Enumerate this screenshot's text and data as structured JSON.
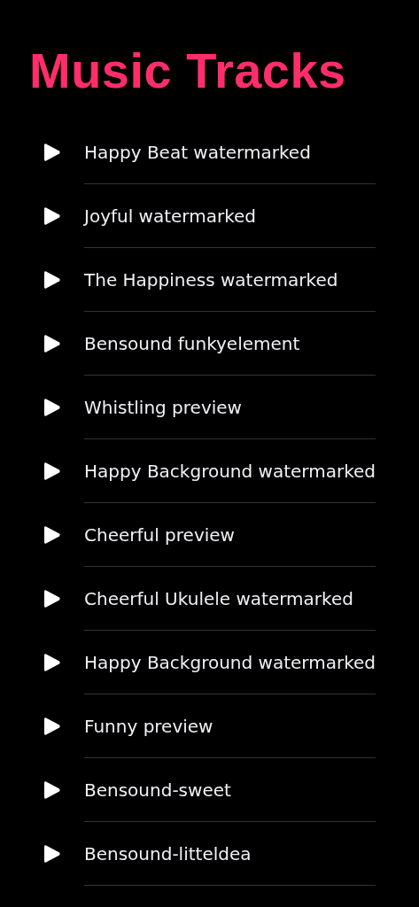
{
  "title": "Music Tracks",
  "tracks": [
    {
      "name": "Happy Beat watermarked"
    },
    {
      "name": "Joyful watermarked"
    },
    {
      "name": "The Happiness watermarked"
    },
    {
      "name": "Bensound funkyelement"
    },
    {
      "name": "Whistling preview"
    },
    {
      "name": "Happy Background watermarked"
    },
    {
      "name": "Cheerful preview"
    },
    {
      "name": "Cheerful Ukulele watermarked"
    },
    {
      "name": "Happy Background watermarked"
    },
    {
      "name": "Funny preview"
    },
    {
      "name": "Bensound-sweet"
    },
    {
      "name": "Bensound-litteldea"
    }
  ]
}
